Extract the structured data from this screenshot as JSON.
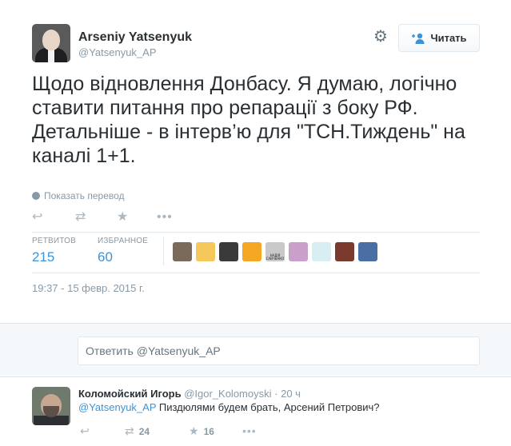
{
  "tweet": {
    "author_name": "Arseniy Yatsenyuk",
    "author_handle": "@Yatsenyuk_AP",
    "text": "Щодо відновлення Донбасу. Я думаю, логічно ставити питання про репарації з боку РФ. Детальніше - в інтерв’ю для \"ТСН.Тиждень\" на каналі 1+1.",
    "follow_label": "Читать",
    "translate_label": "Показать перевод",
    "gear_icon": "gear-icon",
    "stats": {
      "retweets_label": "РЕТВИТОВ",
      "retweets_count": "215",
      "favorites_label": "ИЗБРАННОЕ",
      "favorites_count": "60"
    },
    "favoriter_avatar_colors": [
      "#7a6a5a",
      "#f4c85a",
      "#3a3a3a",
      "#f5a623",
      "#c9c9c9",
      "#c9a0c9",
      "#d8eef2",
      "#7b3a2e",
      "#4a6fa5"
    ],
    "faver_caption": "НАДІЯ САВЧЕНКО",
    "timestamp": "19:37 - 15 февр. 2015 г."
  },
  "reply_box": {
    "placeholder": "Ответить @Yatsenyuk_AP"
  },
  "reply": {
    "author_name": "Коломойский Игорь",
    "author_handle": "@Igor_Kolomoyski",
    "separator": "·",
    "time": "20 ч",
    "mention": "@Yatsenyuk_AP",
    "text": " Пиздюлями будем брать, Арсений Петрович?",
    "retweets_count": "24",
    "favorites_count": "16"
  },
  "colors": {
    "link": "#3b94d9",
    "muted": "#8899a6",
    "text": "#292f33"
  }
}
